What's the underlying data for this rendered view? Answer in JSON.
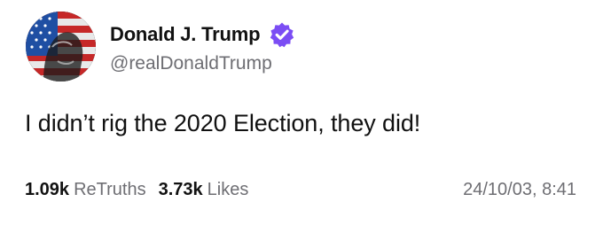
{
  "author": {
    "display_name": "Donald J. Trump",
    "handle": "@realDonaldTrump",
    "verified": true,
    "badge_color": "#6c5ce7"
  },
  "post": {
    "text": "I didn’t rig the 2020 Election, they did!"
  },
  "stats": {
    "retruths_count": "1.09k",
    "retruths_label": "ReTruths",
    "likes_count": "3.73k",
    "likes_label": "Likes"
  },
  "timestamp": "24/10/03, 8:41"
}
